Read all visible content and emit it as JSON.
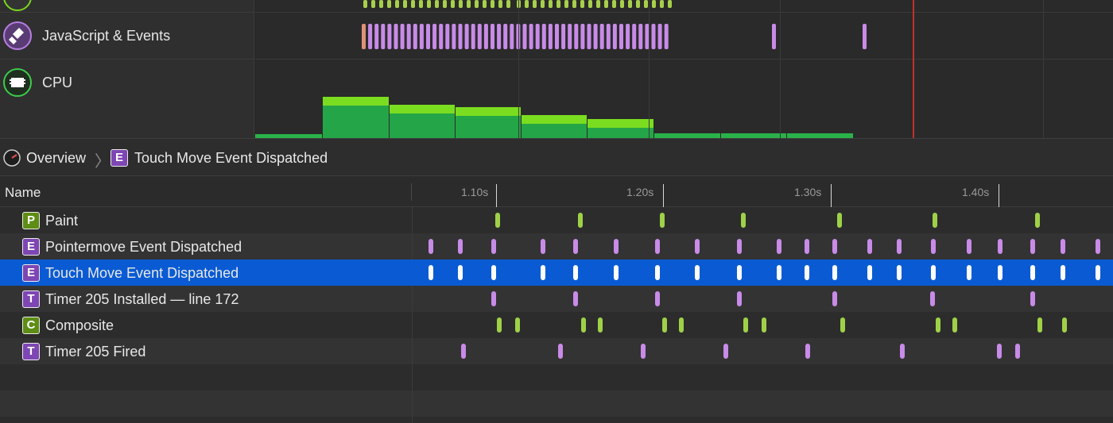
{
  "colors": {
    "purple": "#c88be8",
    "green": "#9fd148",
    "white": "#ffffff",
    "selected_row": "#0a5bd3",
    "cpu_green": "#2ab24a",
    "cpu_light": "#7bdd1f",
    "red_line": "#c4302b"
  },
  "overview": {
    "tracks": [
      {
        "label": "",
        "icon": "rendering-icon"
      },
      {
        "label": "JavaScript & Events",
        "icon": "javascript-events-icon"
      },
      {
        "label": "CPU",
        "icon": "cpu-icon"
      }
    ]
  },
  "breadcrumb": {
    "icon": "overview-icon",
    "root": "Overview",
    "current_badge": "E",
    "current": "Touch Move Event Dispatched"
  },
  "table": {
    "name_header": "Name",
    "ticks": [
      "1.10s",
      "1.20s",
      "1.30s",
      "1.40s"
    ],
    "rows": [
      {
        "badge": "P",
        "label": "Paint"
      },
      {
        "badge": "E",
        "label": "Pointermove Event Dispatched"
      },
      {
        "badge": "E",
        "label": "Touch Move Event Dispatched"
      },
      {
        "badge": "T",
        "label": "Timer 205 Installed — line 172"
      },
      {
        "badge": "C",
        "label": "Composite"
      },
      {
        "badge": "T",
        "label": "Timer 205 Fired"
      }
    ]
  }
}
